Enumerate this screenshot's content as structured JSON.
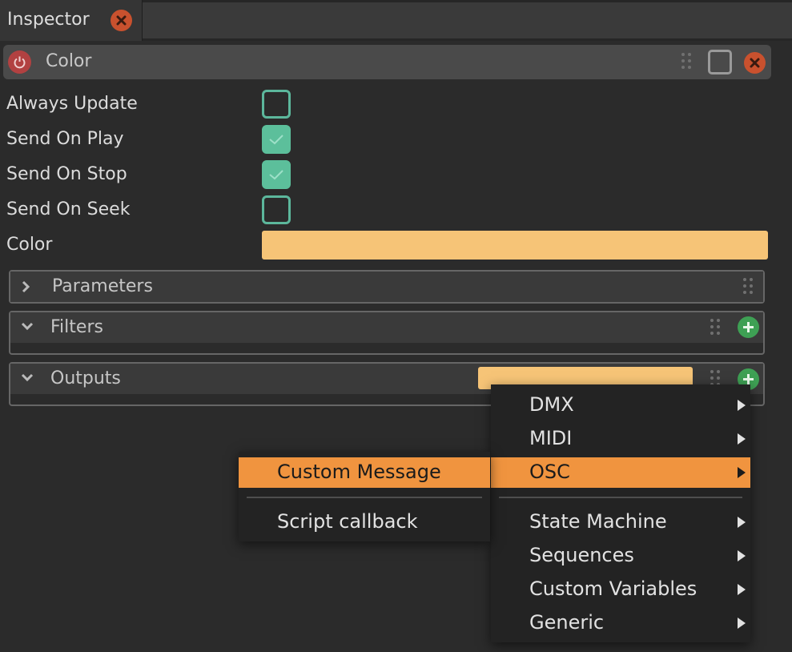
{
  "tab": {
    "title": "Inspector"
  },
  "header": {
    "title": "Color"
  },
  "properties": [
    {
      "label": "Always Update",
      "checked": false
    },
    {
      "label": "Send On Play",
      "checked": true
    },
    {
      "label": "Send On Stop",
      "checked": true
    },
    {
      "label": "Send On Seek",
      "checked": false
    }
  ],
  "color_row": {
    "label": "Color",
    "value": "#f6c477"
  },
  "sections": {
    "parameters": {
      "title": "Parameters",
      "expanded": false
    },
    "filters": {
      "title": "Filters",
      "expanded": true
    },
    "outputs": {
      "title": "Outputs",
      "expanded": true
    }
  },
  "main_menu": {
    "items": [
      "DMX",
      "MIDI",
      "OSC",
      "State Machine",
      "Sequences",
      "Custom Variables",
      "Generic"
    ],
    "active": "OSC"
  },
  "submenu": {
    "items": [
      "Custom Message",
      "Script callback"
    ],
    "active": "Custom Message"
  },
  "colors": {
    "accent_orange": "#f0943f",
    "swatch_yellow": "#f6c477",
    "check_green": "#5cbf9b",
    "add_green": "#3ea054",
    "close_red": "#c9512e"
  },
  "icons": [
    "close-icon",
    "power-icon",
    "grip-icon",
    "checkbox-icon",
    "chevron-right-icon",
    "chevron-down-icon",
    "plus-icon",
    "arrow-right-icon"
  ]
}
